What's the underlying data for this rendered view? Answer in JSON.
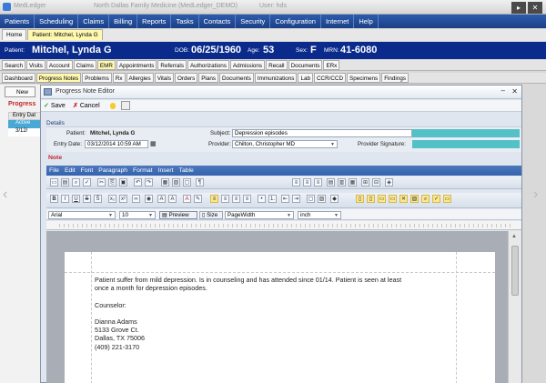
{
  "app": {
    "name": "MedLedger",
    "clinic": "North Dallas Family Medicine (MedLedger_DEMO)",
    "user": "User: hds"
  },
  "main_menu": [
    "Patients",
    "Scheduling",
    "Claims",
    "Billing",
    "Reports",
    "Tasks",
    "Contacts",
    "Security",
    "Configuration",
    "Internet",
    "Help"
  ],
  "doc_tabs": [
    {
      "label": "Home",
      "active": false
    },
    {
      "label": "Patient: Mitchel, Lynda G",
      "active": true
    }
  ],
  "patient": {
    "label": "Patient:",
    "name": "Mitchel, Lynda G",
    "dob_label": "DOB:",
    "dob": "06/25/1960",
    "age_label": "Age:",
    "age": "53",
    "sex_label": "Sex:",
    "sex": "F",
    "mrn_label": "MRN:",
    "mrn": "41-6080"
  },
  "tabs_row1": [
    {
      "label": "Search",
      "hl": false
    },
    {
      "label": "Visits",
      "hl": false
    },
    {
      "label": "Account",
      "hl": false
    },
    {
      "label": "Claims",
      "hl": false
    },
    {
      "label": "EMR",
      "hl": true
    },
    {
      "label": "Appointments",
      "hl": false
    },
    {
      "label": "Referrals",
      "hl": false
    },
    {
      "label": "Authorizations",
      "hl": false
    },
    {
      "label": "Admissions",
      "hl": false
    },
    {
      "label": "Recall",
      "hl": false
    },
    {
      "label": "Documents",
      "hl": false
    },
    {
      "label": "ERx",
      "hl": false
    }
  ],
  "tabs_row2": [
    {
      "label": "Dashboard",
      "hl": false
    },
    {
      "label": "Progress Notes",
      "hl": true
    },
    {
      "label": "Problems",
      "hl": false
    },
    {
      "label": "Rx",
      "hl": false
    },
    {
      "label": "Allergies",
      "hl": false
    },
    {
      "label": "Vitals",
      "hl": false
    },
    {
      "label": "Orders",
      "hl": false
    },
    {
      "label": "Plans",
      "hl": false
    },
    {
      "label": "Documents",
      "hl": false
    },
    {
      "label": "Immunizations",
      "hl": false
    },
    {
      "label": "Lab",
      "hl": false
    },
    {
      "label": "CCR/CCD",
      "hl": false
    },
    {
      "label": "Specimens",
      "hl": false
    },
    {
      "label": "Findings",
      "hl": false
    }
  ],
  "bg_panel": {
    "new_label": "New",
    "title": "Progress",
    "col_header": "Entry Dat",
    "group": "Active",
    "row": "3/12/"
  },
  "dialog": {
    "title": "Progress Note Editor",
    "save": "Save",
    "cancel": "Cancel",
    "details_header": "Details",
    "patient_label": "Patient:",
    "patient_value": "Mitchel, Lynda G",
    "entry_label": "Entry Date:",
    "entry_value": "03/12/2014 10:59 AM",
    "subject_label": "Subject:",
    "subject_value": "Depression episodes",
    "provider_label": "Provider:",
    "provider_value": "Chilton, Christopher  MD",
    "signature_label": "Provider Signature:",
    "note_header": "Note"
  },
  "editor": {
    "menu": [
      "File",
      "Edit",
      "Font",
      "Paragraph",
      "Format",
      "Insert",
      "Table"
    ],
    "font": "Arial",
    "size": "10",
    "preview": "Preview",
    "size_label": "Size",
    "page_width": "PageWidth",
    "unit": "inch",
    "body": [
      "Patient suffer from mild depression. Is in counseling and has attended since 01/14. Patient is seen at least",
      "once a month for depression episodes.",
      "",
      "Counselor:",
      "",
      "Dianna Adams",
      "5133 Grove Ct.",
      "Dallas, TX 75006",
      "(409) 221-3170"
    ]
  }
}
